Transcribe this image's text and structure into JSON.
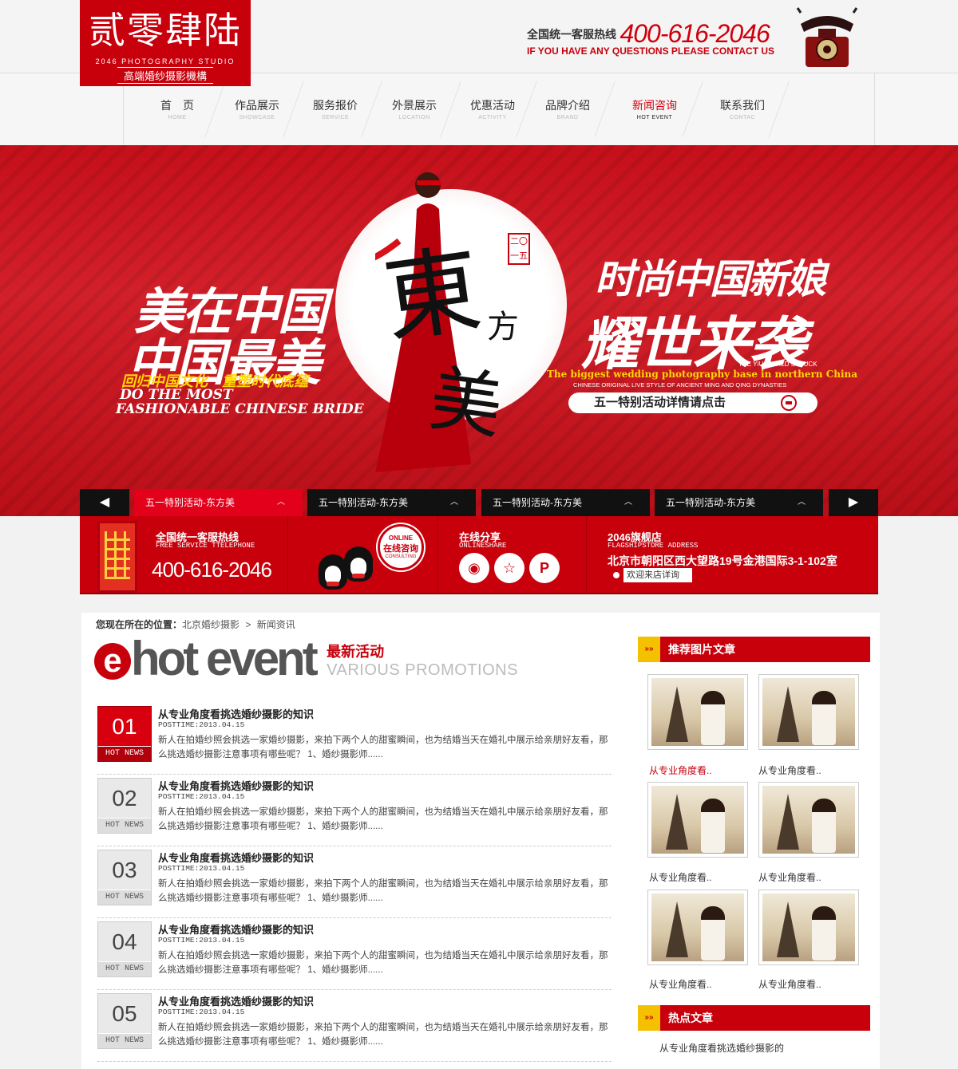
{
  "brand": {
    "logo_cn": "贰零肆陆",
    "logo_en": "2046 PHOTOGRAPHY STUDIO",
    "logo_sub": "高端婚纱摄影機構",
    "hotline_label": "全国统一客服热线",
    "hotline_number": "400-616-2046",
    "hotline_en": "IF YOU HAVE ANY QUESTIONS PLEASE CONTACT US"
  },
  "nav": [
    {
      "cn": "首　页",
      "en": "HOME"
    },
    {
      "cn": "作品展示",
      "en": "SHOWCASE"
    },
    {
      "cn": "服务报价",
      "en": "SERVICE"
    },
    {
      "cn": "外景展示",
      "en": "LOCATION"
    },
    {
      "cn": "优惠活动",
      "en": "ACTIVITY"
    },
    {
      "cn": "品牌介绍",
      "en": "BRAND"
    },
    {
      "cn": "新闻咨询",
      "en": "HOT EVENT",
      "active": true
    },
    {
      "cn": "联系我们",
      "en": "CONTAC"
    }
  ],
  "banner": {
    "left_line1": "美在中国",
    "left_line2": "中国最美",
    "left_line3": "回归中国文化　重塑时代底蕴",
    "left_line4": "DO THE MOST",
    "left_line5": "FASHIONABLE CHINESE BRIDE",
    "mid_big1": "東",
    "mid_big2": "美",
    "mid_small": "方",
    "seal": "二〇一五",
    "right_line1": "时尚中国新娘",
    "right_line2": "耀世来袭",
    "right_line3": "THE YIU WORLD STRUCK",
    "right_line4": "The biggest wedding photography base in northern China",
    "right_line5": "CHINESE ORIGINAL LIVE STYLE OF ANCIENT MING AND QING DYNASTIES",
    "button": "五一特别活动详情请点击"
  },
  "slider_tabs": [
    {
      "label": "五一特别活动-东方美",
      "active": true
    },
    {
      "label": "五一特别活动-东方美"
    },
    {
      "label": "五一特别活动-东方美"
    },
    {
      "label": "五一特别活动-东方美"
    }
  ],
  "info": {
    "hotline_title": "全国统一客服热线",
    "hotline_en": "FREE SERVICE TTELEPHONE",
    "hotline_number": "400-616-2046",
    "online_a": "ONLINE",
    "online_b": "在线咨询",
    "online_c": "CONSULTING",
    "share_title": "在线分享",
    "share_en": "ONLINESHARE",
    "store_title": "2046旗舰店",
    "store_en": "FLAGSHIPSTORE ADDRESS",
    "store_address": "北京市朝阳区西大望路19号金港国际3-1-102室",
    "store_visit": "欢迎来店详询"
  },
  "breadcrumb": {
    "label": "您现在所在的位置：",
    "items": [
      "北京婚纱摄影",
      ">",
      "新闻资讯"
    ]
  },
  "section": {
    "e": "e",
    "word": "hot event",
    "cn": "最新活动",
    "en": "VARIOUS PROMOTIONS"
  },
  "news": [
    {
      "num": "01",
      "badge": "HOT NEWS",
      "title": "从专业角度看挑选婚纱摄影的知识",
      "date": "POSTTIME:2013.04.15",
      "excerpt": "新人在拍婚纱照会挑选一家婚纱摄影，来拍下两个人的甜蜜瞬间，也为结婚当天在婚礼中展示给亲朋好友看，那么挑选婚纱摄影注意事项有哪些呢？ 1、婚纱摄影师......"
    },
    {
      "num": "02",
      "badge": "HOT NEWS",
      "title": "从专业角度看挑选婚纱摄影的知识",
      "date": "POSTTIME:2013.04.15",
      "excerpt": "新人在拍婚纱照会挑选一家婚纱摄影，来拍下两个人的甜蜜瞬间，也为结婚当天在婚礼中展示给亲朋好友看，那么挑选婚纱摄影注意事项有哪些呢？ 1、婚纱摄影师......"
    },
    {
      "num": "03",
      "badge": "HOT NEWS",
      "title": "从专业角度看挑选婚纱摄影的知识",
      "date": "POSTTIME:2013.04.15",
      "excerpt": "新人在拍婚纱照会挑选一家婚纱摄影，来拍下两个人的甜蜜瞬间，也为结婚当天在婚礼中展示给亲朋好友看，那么挑选婚纱摄影注意事项有哪些呢？ 1、婚纱摄影师......"
    },
    {
      "num": "04",
      "badge": "HOT NEWS",
      "title": "从专业角度看挑选婚纱摄影的知识",
      "date": "POSTTIME:2013.04.15",
      "excerpt": "新人在拍婚纱照会挑选一家婚纱摄影，来拍下两个人的甜蜜瞬间，也为结婚当天在婚礼中展示给亲朋好友看，那么挑选婚纱摄影注意事项有哪些呢？ 1、婚纱摄影师......"
    },
    {
      "num": "05",
      "badge": "HOT NEWS",
      "title": "从专业角度看挑选婚纱摄影的知识",
      "date": "POSTTIME:2013.04.15",
      "excerpt": "新人在拍婚纱照会挑选一家婚纱摄影，来拍下两个人的甜蜜瞬间，也为结婚当天在婚礼中展示给亲朋好友看，那么挑选婚纱摄影注意事项有哪些呢？ 1、婚纱摄影师......"
    }
  ],
  "sidebar": {
    "recommend_title": "推荐图片文章",
    "icon_glyph": "»»",
    "thumbs": [
      {
        "caption": "从专业角度看..",
        "active": true
      },
      {
        "caption": "从专业角度看.."
      },
      {
        "caption": "从专业角度看.."
      },
      {
        "caption": "从专业角度看.."
      },
      {
        "caption": "从专业角度看.."
      },
      {
        "caption": "从专业角度看.."
      }
    ],
    "hot_title": "热点文章",
    "hot_items": [
      "从专业角度看挑选婚纱摄影的"
    ]
  },
  "colors": {
    "primary_red": "#c8000c",
    "accent_yellow": "#f5c000"
  }
}
